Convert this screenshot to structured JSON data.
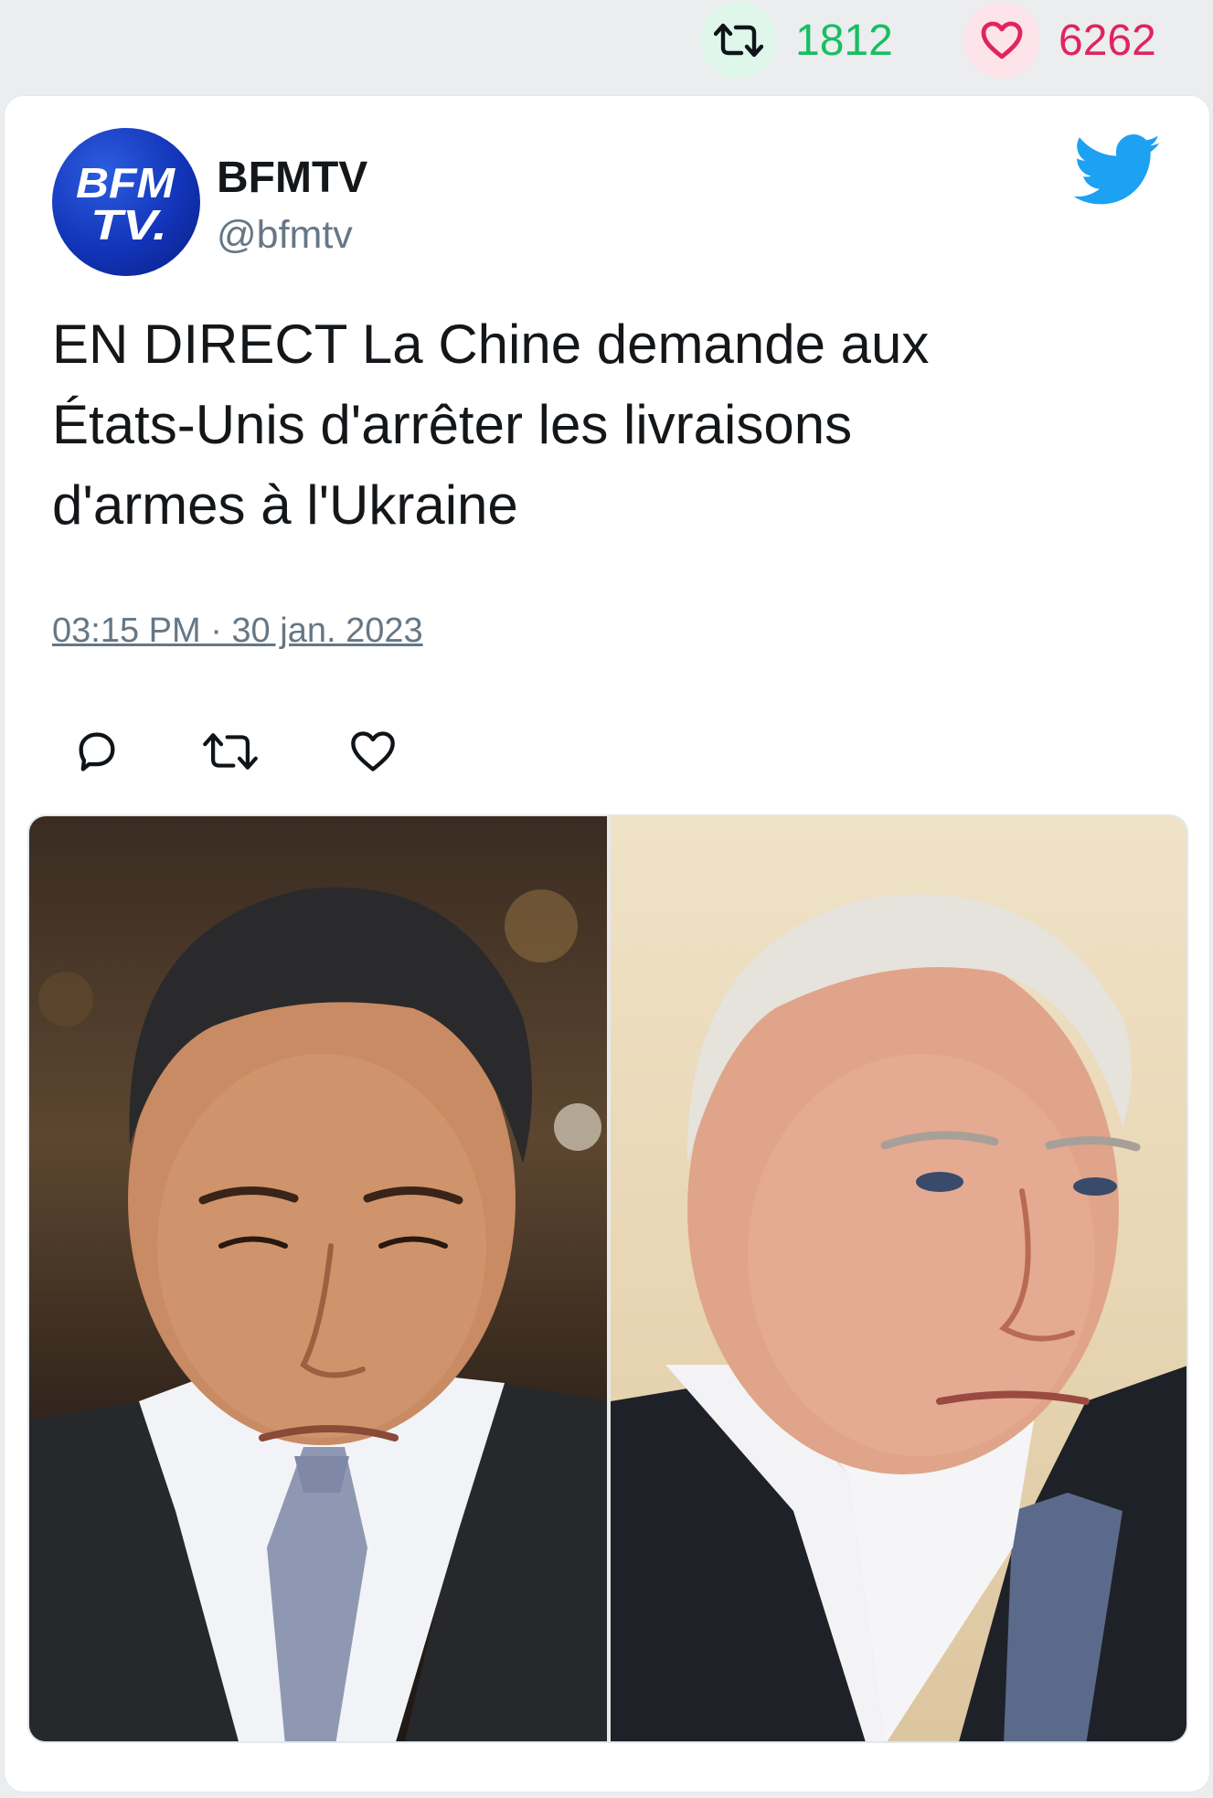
{
  "stats": {
    "retweet_count": "1812",
    "like_count": "6262",
    "retweet_color": "#17bf63",
    "like_color": "#e0245e"
  },
  "tweet": {
    "author_name": "BFMTV",
    "author_handle": "@bfmtv",
    "avatar_logo_text": [
      "BFM",
      "TV."
    ],
    "platform_icon": "twitter-bird-icon",
    "text_lines": [
      "EN DIRECT La Chine demande aux",
      "États-Unis d'arrêter les livraisons",
      "d'armes à l'Ukraine"
    ],
    "timestamp": "03:15 PM · 30 jan. 2023",
    "actions": [
      "reply-icon",
      "retweet-icon",
      "like-icon"
    ],
    "accent_color": "#1da1f2"
  },
  "media": {
    "type": "photo",
    "panels": [
      "left-portrait-photo",
      "right-portrait-photo"
    ]
  }
}
